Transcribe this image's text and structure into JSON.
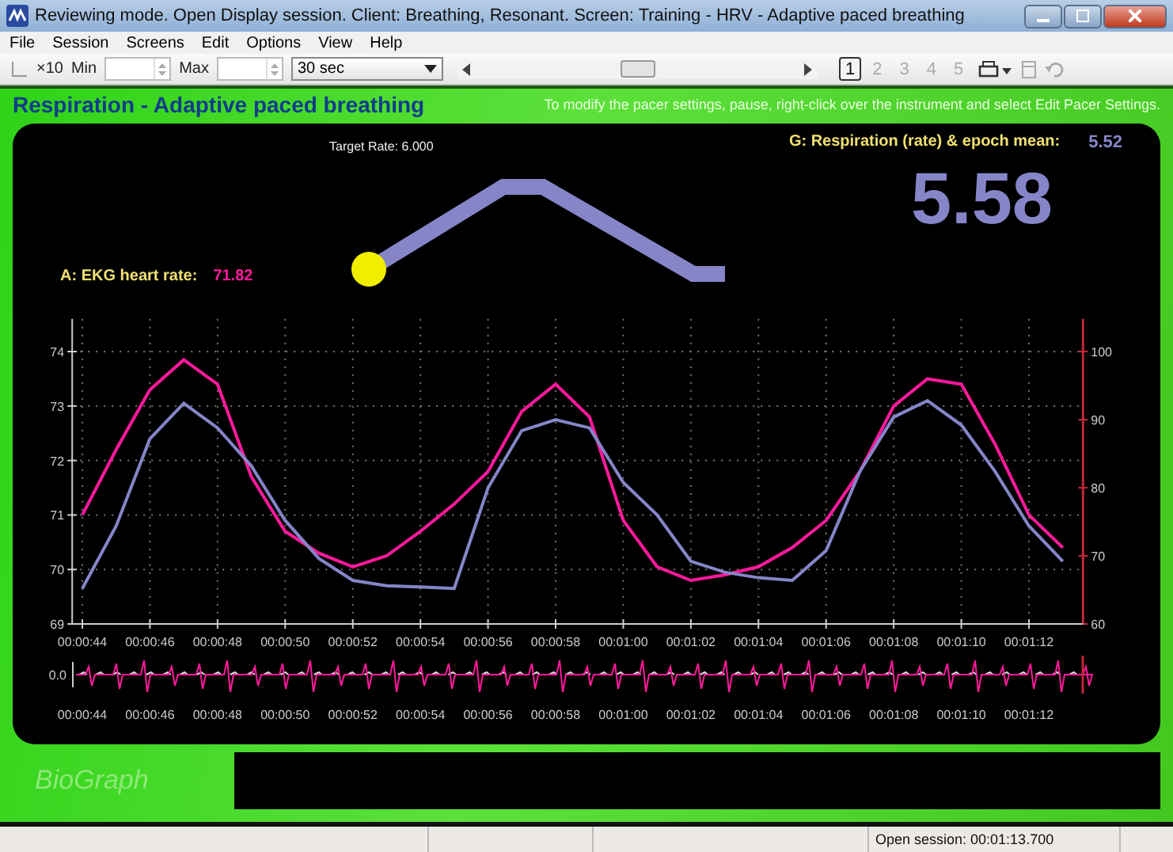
{
  "window": {
    "title": "Reviewing mode. Open Display session. Client: Breathing, Resonant. Screen: Training - HRV - Adaptive paced breathing"
  },
  "menu": [
    "File",
    "Session",
    "Screens",
    "Edit",
    "Options",
    "View",
    "Help"
  ],
  "toolbar": {
    "scale_label": "×10",
    "min_label": "Min",
    "max_label": "Max",
    "timebase": "30 sec",
    "pages": [
      {
        "label": "1",
        "selected": true
      },
      {
        "label": "2",
        "selected": false
      },
      {
        "label": "3",
        "selected": false
      },
      {
        "label": "4",
        "selected": false
      },
      {
        "label": "5",
        "selected": false
      }
    ]
  },
  "screen_header": {
    "title": "Respiration - Adaptive paced breathing",
    "hint": "To modify the pacer settings, pause, right-click over the instrument and select Edit Pacer Settings."
  },
  "instrument": {
    "target_rate": "Target Rate: 6.000",
    "heart_rate": {
      "label": "A: EKG heart rate:",
      "value": "71.82"
    },
    "respiration": {
      "label": "G: Respiration (rate) & epoch mean:",
      "value": "5.52",
      "big_value": "5.58"
    },
    "chart_data": {
      "type": "line",
      "x": [
        44,
        45,
        46,
        47,
        48,
        49,
        50,
        51,
        52,
        53,
        54,
        55,
        56,
        57,
        58,
        59,
        60,
        61,
        62,
        63,
        64,
        65,
        66,
        67,
        68,
        69,
        70,
        71,
        72,
        73
      ],
      "xticks": [
        {
          "value": 44,
          "label": "00:00:44"
        },
        {
          "value": 46,
          "label": "00:00:46"
        },
        {
          "value": 48,
          "label": "00:00:48"
        },
        {
          "value": 50,
          "label": "00:00:50"
        },
        {
          "value": 52,
          "label": "00:00:52"
        },
        {
          "value": 54,
          "label": "00:00:54"
        },
        {
          "value": 56,
          "label": "00:00:56"
        },
        {
          "value": 58,
          "label": "00:00:58"
        },
        {
          "value": 60,
          "label": "00:01:00"
        },
        {
          "value": 62,
          "label": "00:01:02"
        },
        {
          "value": 64,
          "label": "00:01:04"
        },
        {
          "value": 66,
          "label": "00:01:06"
        },
        {
          "value": 68,
          "label": "00:01:08"
        },
        {
          "value": 70,
          "label": "00:01:10"
        },
        {
          "value": 72,
          "label": "00:01:12"
        }
      ],
      "yticks": [
        69,
        70,
        71,
        72,
        73,
        74
      ],
      "ylim": [
        69,
        74.6
      ],
      "xlim": [
        43.7,
        73.6
      ],
      "grid": true,
      "series": [
        {
          "color": "#ff1a9c",
          "values": [
            71.0,
            72.2,
            73.3,
            73.85,
            73.4,
            71.7,
            70.7,
            70.3,
            70.05,
            70.25,
            70.7,
            71.2,
            71.8,
            72.9,
            73.4,
            72.8,
            70.9,
            70.05,
            69.8,
            69.9,
            70.05,
            70.4,
            70.9,
            71.8,
            73.0,
            73.5,
            73.4,
            72.3,
            71.0,
            70.4
          ]
        },
        {
          "color": "#8585c8",
          "values": [
            69.65,
            70.8,
            72.4,
            73.05,
            72.6,
            71.9,
            70.9,
            70.2,
            69.8,
            69.7,
            69.68,
            69.65,
            71.5,
            72.55,
            72.75,
            72.6,
            71.6,
            71.0,
            70.15,
            69.95,
            69.85,
            69.8,
            70.35,
            71.8,
            72.8,
            73.1,
            72.65,
            71.8,
            70.8,
            70.15
          ]
        }
      ]
    },
    "right_yticks": [
      "100",
      "90",
      "80",
      "70",
      "60"
    ],
    "strip": {
      "label": "0.0",
      "xticks": [
        "00:00:44",
        "00:00:46",
        "00:00:48",
        "00:00:50",
        "00:00:52",
        "00:00:54",
        "00:00:56",
        "00:00:58",
        "00:01:00",
        "00:01:02",
        "00:01:04",
        "00:01:06",
        "00:01:08",
        "00:01:10",
        "00:01:12"
      ]
    }
  },
  "logo": "BioGraph",
  "status_bar": [
    "Open session: 00:01:13.700"
  ]
}
